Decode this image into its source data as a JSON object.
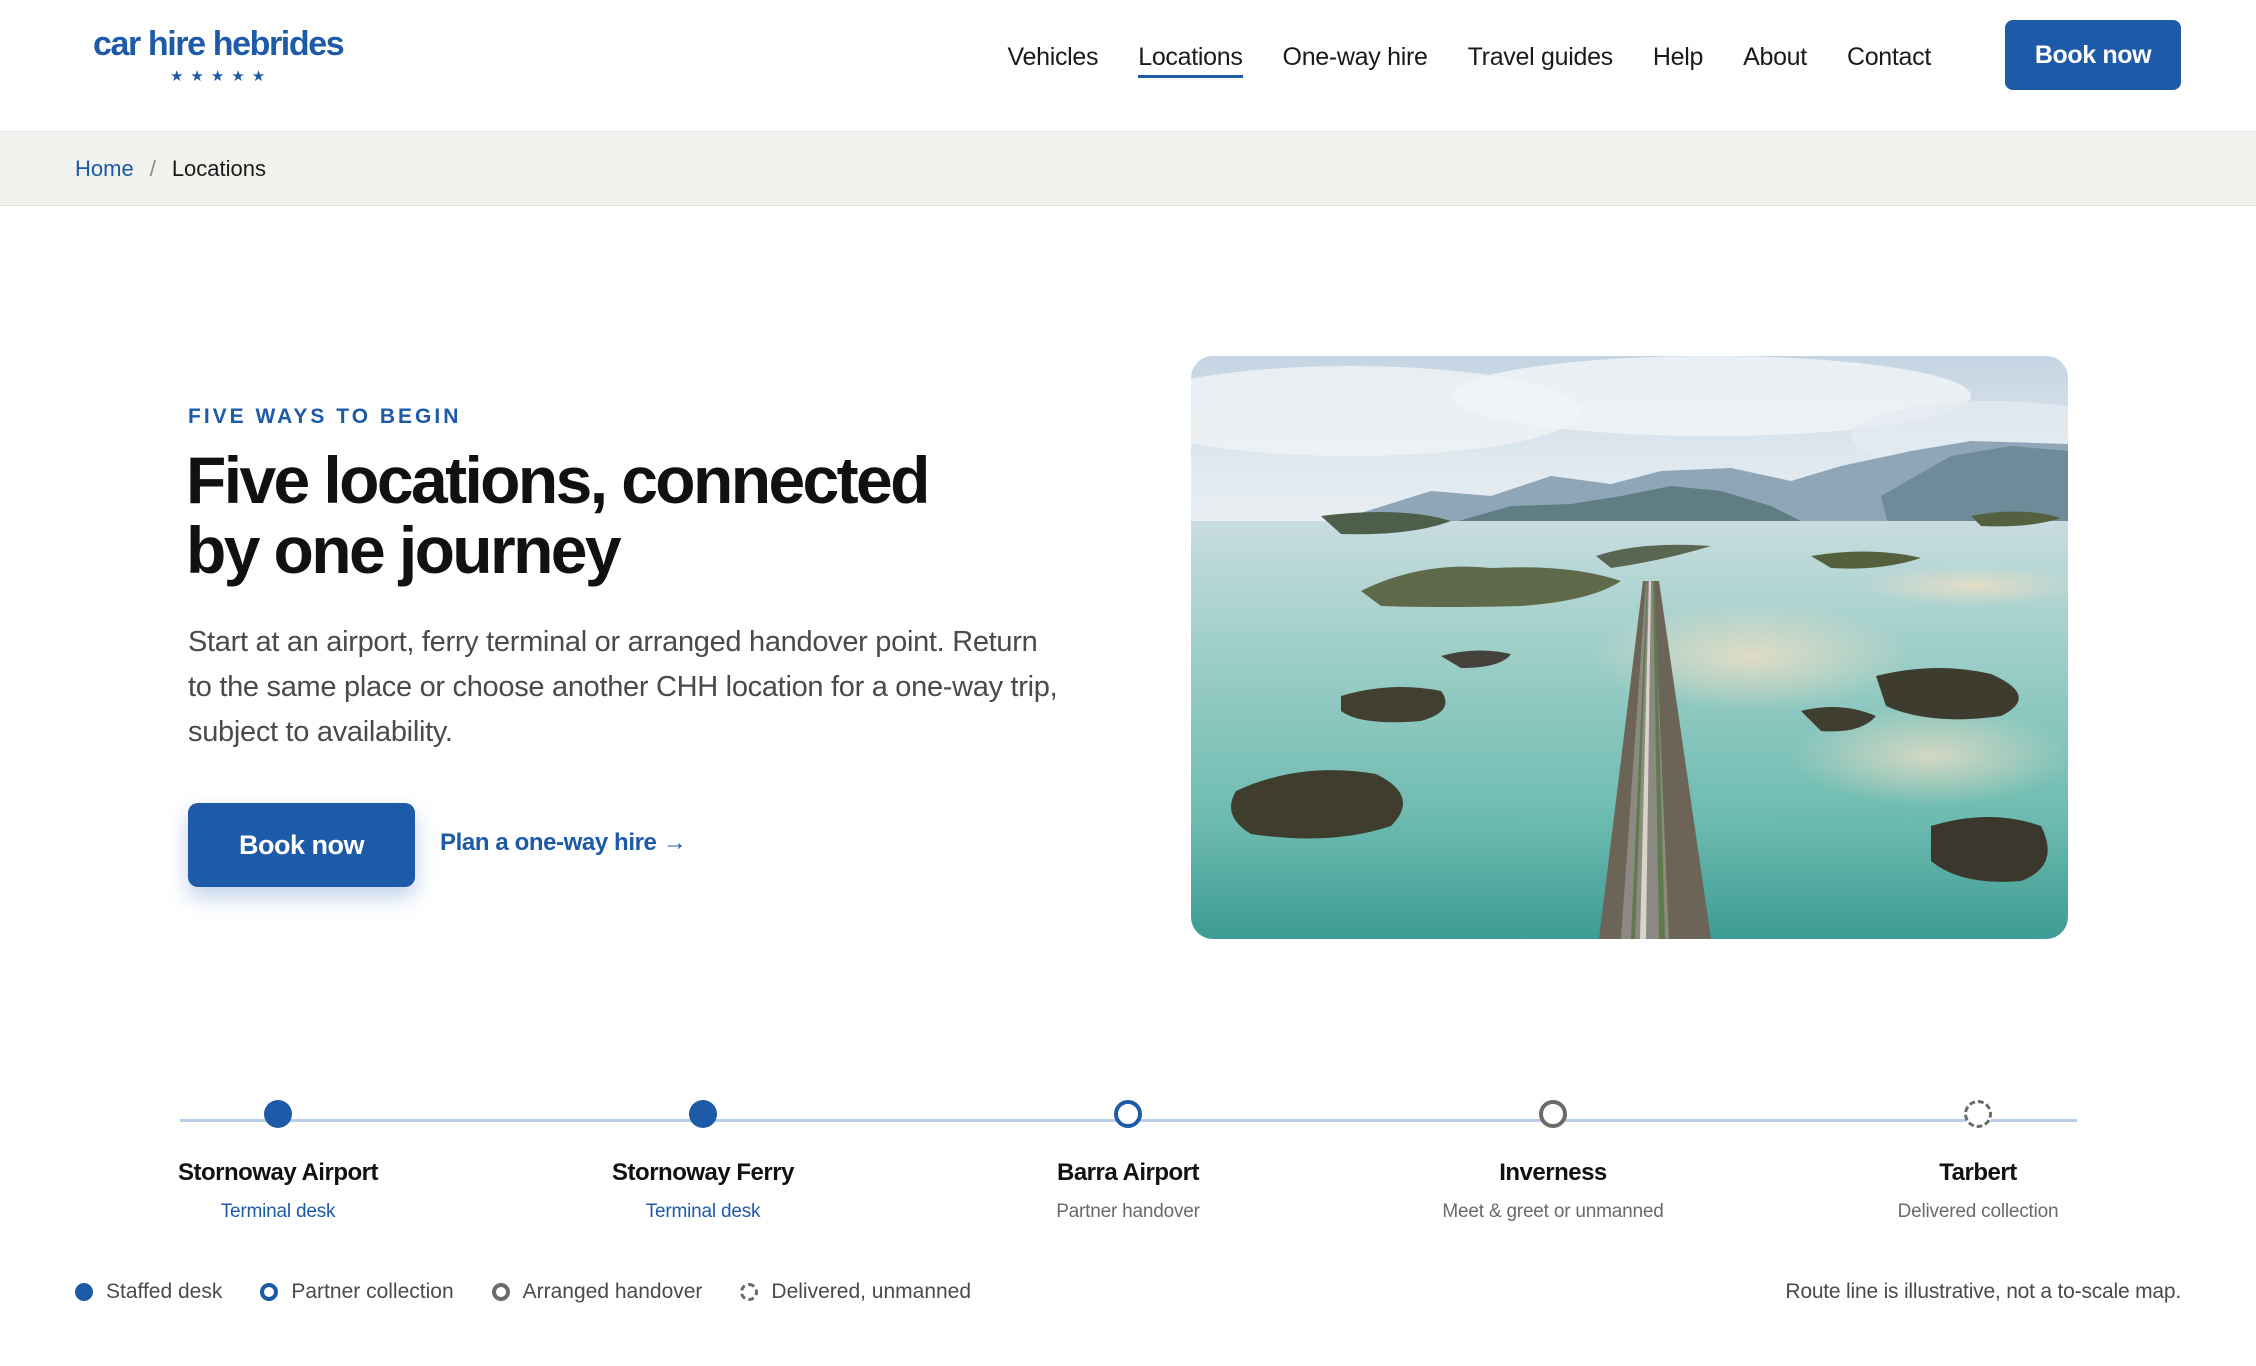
{
  "brand": {
    "name": "car hire hebrides",
    "stars": "★★★★★",
    "accent": "#1d5aa8"
  },
  "nav": {
    "items": [
      {
        "label": "Vehicles",
        "active": false
      },
      {
        "label": "Locations",
        "active": true
      },
      {
        "label": "One-way hire",
        "active": false
      },
      {
        "label": "Travel guides",
        "active": false
      },
      {
        "label": "Help",
        "active": false
      },
      {
        "label": "About",
        "active": false
      },
      {
        "label": "Contact",
        "active": false
      }
    ],
    "book_label": "Book now"
  },
  "breadcrumb": {
    "home": "Home",
    "separator": "/",
    "current": "Locations"
  },
  "hero": {
    "eyebrow": "FIVE WAYS TO BEGIN",
    "title": "Five locations, connected by one journey",
    "description": "Start at an airport, ferry terminal or arranged handover point. Return to the same place or choose another CHH location for a one-way trip, subject to availability.",
    "book_label": "Book now",
    "oneway_link": "Plan a one-way hire →"
  },
  "route": {
    "stops": [
      {
        "name": "Stornoway Airport",
        "type": "Terminal desk",
        "kind": "staffed"
      },
      {
        "name": "Stornoway Ferry",
        "type": "Terminal desk",
        "kind": "staffed"
      },
      {
        "name": "Barra Airport",
        "type": "Partner handover",
        "kind": "partner"
      },
      {
        "name": "Inverness",
        "type": "Meet & greet or unmanned",
        "kind": "handover"
      },
      {
        "name": "Tarbert",
        "type": "Delivered collection",
        "kind": "delivered"
      }
    ],
    "note": "Route line is illustrative, not a to-scale map."
  },
  "legend": {
    "staffed": "Staffed desk",
    "partner": "Partner collection",
    "handover": "Arranged handover",
    "delivered": "Delivered, unmanned"
  }
}
